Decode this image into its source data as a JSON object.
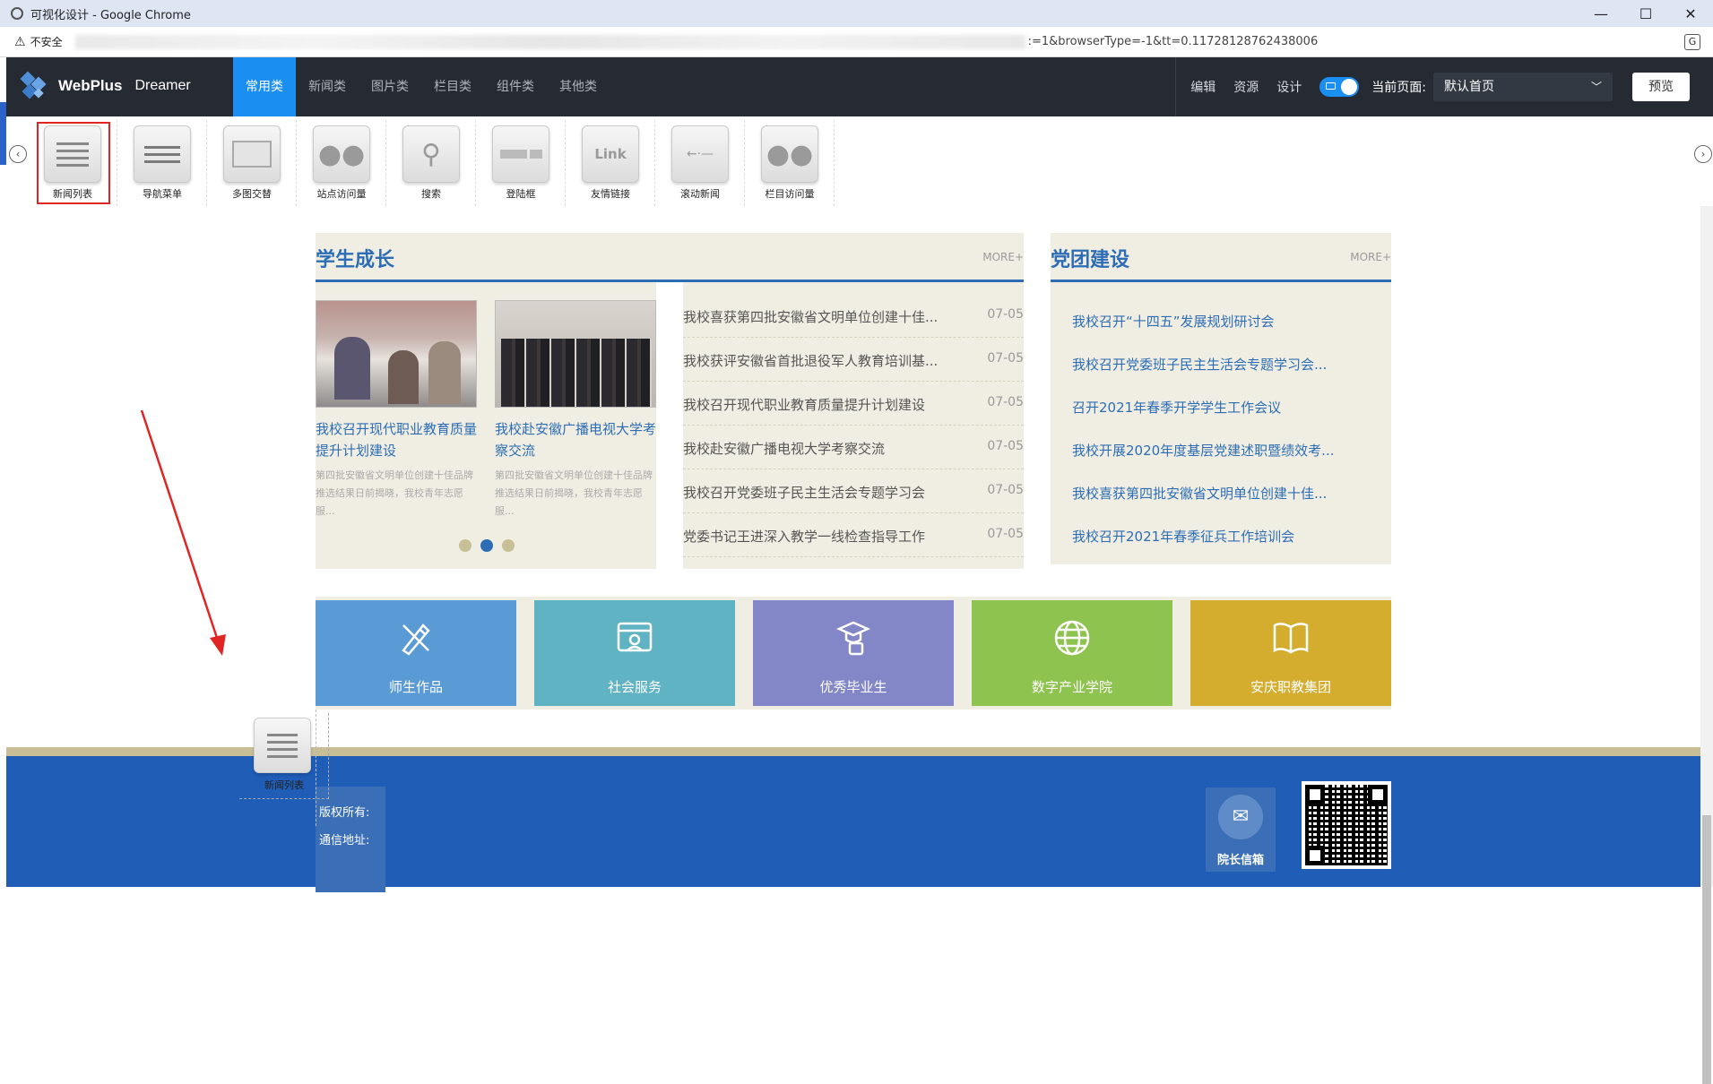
{
  "window": {
    "title": "可视化设计 - Google Chrome",
    "minimize": "—",
    "maximize": "☐",
    "close": "✕"
  },
  "address": {
    "security_label": "不安全",
    "url_tail": ":=1&browserType=-1&tt=0.11728128762438006"
  },
  "header": {
    "brand": "WebPlus",
    "product": "Dreamer",
    "tabs": [
      "常用类",
      "新闻类",
      "图片类",
      "栏目类",
      "组件类",
      "其他类"
    ],
    "actions": [
      "编辑",
      "资源",
      "设计"
    ],
    "page_label": "当前页面:",
    "page_select": "默认首页",
    "preview": "预览"
  },
  "components": [
    {
      "label": "新闻列表",
      "icon": "news-list-icon"
    },
    {
      "label": "导航菜单",
      "icon": "nav-menu-icon"
    },
    {
      "label": "多图交替",
      "icon": "multi-image-icon"
    },
    {
      "label": "站点访问量",
      "icon": "visitors-icon"
    },
    {
      "label": "搜索",
      "icon": "search-icon"
    },
    {
      "label": "登陆框",
      "icon": "login-box-icon"
    },
    {
      "label": "友情链接",
      "icon": "link-icon"
    },
    {
      "label": "滚动新闻",
      "icon": "scroll-news-icon"
    },
    {
      "label": "栏目访问量",
      "icon": "column-visitors-icon"
    }
  ],
  "student": {
    "title": "学生成长",
    "more": "MORE+",
    "pics": [
      {
        "caption": "我校召开现代职业教育质量提升计划建设",
        "desc": "第四批安徽省文明单位创建十佳品牌推选结果日前揭晓，我校青年志愿服..."
      },
      {
        "caption": "我校赴安徽广播电视大学考察交流",
        "desc": "第四批安徽省文明单位创建十佳品牌推选结果日前揭晓，我校青年志愿服..."
      }
    ],
    "news": [
      {
        "title": "我校喜获第四批安徽省文明单位创建十佳...",
        "date": "07-05"
      },
      {
        "title": "我校获评安徽省首批退役军人教育培训基...",
        "date": "07-05"
      },
      {
        "title": "我校召开现代职业教育质量提升计划建设",
        "date": "07-05"
      },
      {
        "title": "我校赴安徽广播电视大学考察交流",
        "date": "07-05"
      },
      {
        "title": "我校召开党委班子民主生活会专题学习会",
        "date": "07-05"
      },
      {
        "title": "党委书记王进深入教学一线检查指导工作",
        "date": "07-05"
      }
    ]
  },
  "party": {
    "title": "党团建设",
    "more": "MORE+",
    "items": [
      "我校召开“十四五”发展规划研讨会",
      "我校召开党委班子民主生活会专题学习会...",
      "召开2021年春季开学学生工作会议",
      "我校开展2020年度基层党建述职暨绩效考...",
      "我校喜获第四批安徽省文明单位创建十佳...",
      "我校召开2021年春季征兵工作培训会"
    ]
  },
  "tiles": [
    {
      "label": "师生作品",
      "color": "#5b9bd5",
      "icon": "pencil-ruler-icon"
    },
    {
      "label": "社会服务",
      "color": "#5fb3c2",
      "icon": "service-icon"
    },
    {
      "label": "优秀毕业生",
      "color": "#8387c7",
      "icon": "graduate-icon"
    },
    {
      "label": "数字产业学院",
      "color": "#8fc34f",
      "icon": "globe-icon"
    },
    {
      "label": "安庆职教集团",
      "color": "#d4ad2f",
      "icon": "book-icon"
    }
  ],
  "footer": {
    "copyright": "版权所有:",
    "address": "通信地址:",
    "mailbox": "院长信箱"
  },
  "drag": {
    "label": "新闻列表"
  },
  "colors": {
    "accent": "#1b8ef2",
    "header_bg": "#262b33",
    "section_blue": "#2d6db5",
    "footer_blue": "#1f5db6",
    "beige": "#f0eee2"
  }
}
